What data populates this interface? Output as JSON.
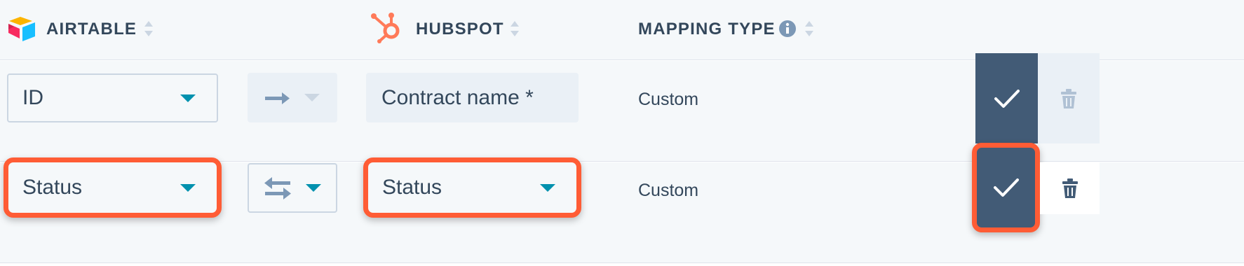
{
  "header": {
    "airtable_label": "AIRTABLE",
    "hubspot_label": "HUBSPOT",
    "mapping_type_label": "MAPPING TYPE"
  },
  "rows": [
    {
      "airtable_field": "ID",
      "direction": "one-way",
      "hubspot_field": "Contract name *",
      "mapping_type": "Custom"
    },
    {
      "airtable_field": "Status",
      "direction": "two-way",
      "hubspot_field": "Status",
      "mapping_type": "Custom"
    }
  ],
  "icons": {
    "airtable": "airtable-logo-icon",
    "hubspot": "hubspot-logo-icon",
    "info": "info-icon",
    "sort": "sort-icon",
    "one_way": "arrow-right-icon",
    "two_way": "two-way-arrows-icon",
    "check": "checkmark-icon",
    "trash": "trash-icon"
  },
  "colors": {
    "accent": "#0091ae",
    "highlight": "#ff5c35",
    "button_dark": "#425b76",
    "hubspot_orange": "#ff7a59"
  }
}
